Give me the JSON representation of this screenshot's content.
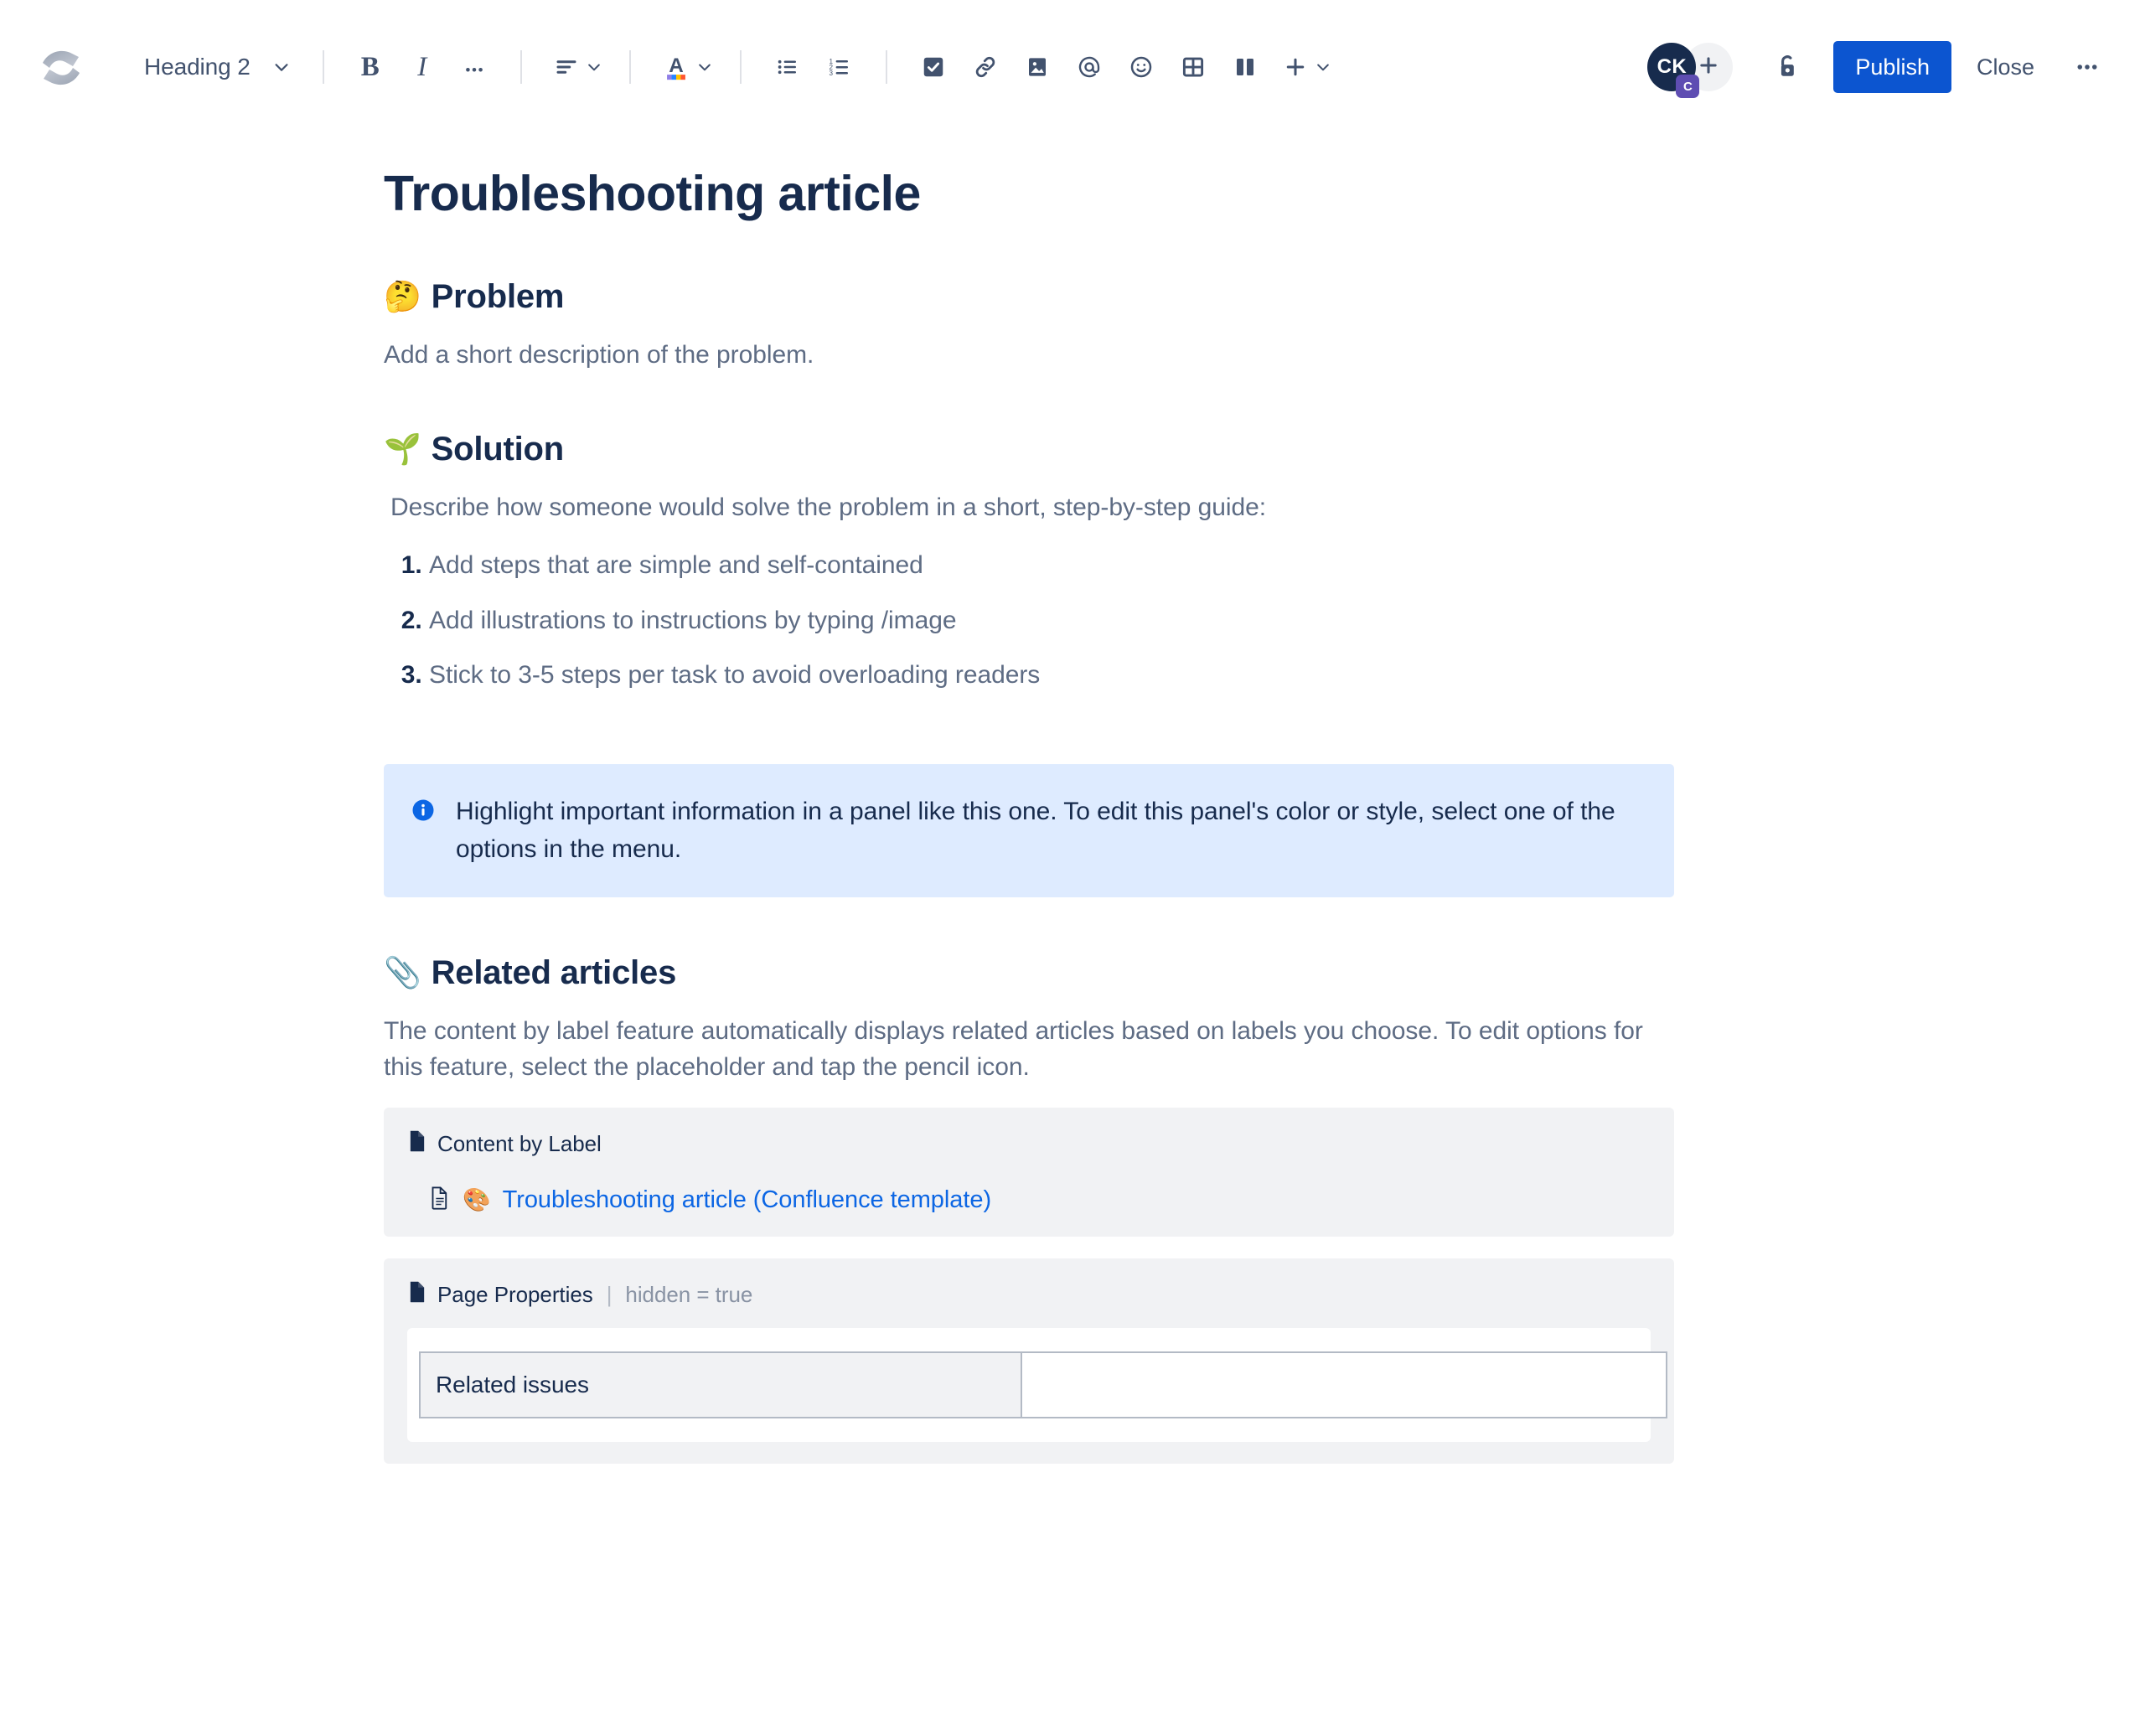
{
  "app": {
    "logo_icon": "confluence-logo-icon"
  },
  "toolbar": {
    "style_select": {
      "value": "Heading 2",
      "icon": "chevron-down-icon"
    },
    "bold": {
      "label": "B",
      "icon": "bold-icon"
    },
    "italic": {
      "label": "I",
      "icon": "italic-icon"
    },
    "more_formatting": {
      "icon": "ellipsis-icon"
    },
    "alignment": {
      "icon": "text-align-left-icon"
    },
    "text_color": {
      "icon": "text-color-icon"
    },
    "bullet_list": {
      "icon": "bullet-list-icon"
    },
    "numbered_list": {
      "icon": "numbered-list-icon"
    },
    "task_list": {
      "icon": "checkbox-icon"
    },
    "link": {
      "icon": "link-icon"
    },
    "image": {
      "icon": "image-icon"
    },
    "mention": {
      "icon": "mention-at-icon"
    },
    "emoji": {
      "icon": "emoji-smiley-icon"
    },
    "table": {
      "icon": "table-icon"
    },
    "layout": {
      "icon": "columns-layout-icon"
    },
    "insert_more": {
      "icon": "plus-icon"
    },
    "avatar": {
      "initials": "CK",
      "badge": "C"
    },
    "add_people": {
      "icon": "plus-icon"
    },
    "restrictions": {
      "icon": "unlock-icon"
    },
    "publish_label": "Publish",
    "close_label": "Close",
    "more_options": {
      "icon": "ellipsis-icon"
    }
  },
  "colors": {
    "accent_blue": "#0C55D0",
    "link_blue": "#0C66E4",
    "panel_bg": "#DEEBFF",
    "macro_bg": "#F1F2F4",
    "text_dark": "#172B4D",
    "text_muted": "#5E6C84",
    "badge_purple": "#5E4DB2"
  },
  "document": {
    "title": "Troubleshooting article",
    "sections": [
      {
        "emoji": "🤔",
        "emoji_name": "thinking-face-emoji",
        "heading": "Problem",
        "paragraph": "Add a short description of the problem."
      },
      {
        "emoji": "🌱",
        "emoji_name": "seedling-emoji",
        "heading": "Solution",
        "paragraph": "Describe how someone would solve the problem in a short, step-by-step guide:",
        "steps": [
          "Add steps that are simple and self-contained",
          "Add illustrations to instructions by typing /image",
          "Stick to 3-5 steps per task to avoid overloading readers"
        ]
      },
      {
        "emoji": "📎",
        "emoji_name": "paperclip-emoji",
        "heading": "Related articles",
        "paragraph": "The content by label feature automatically displays related articles based on labels you choose. To edit options for this feature, select the placeholder and tap the pencil icon."
      }
    ],
    "info_panel": {
      "icon": "info-circle-icon",
      "text": "Highlight important information in a panel like this one. To edit this panel's color or style, select one of the options in the menu."
    },
    "content_by_label_macro": {
      "icon": "macro-page-icon",
      "title": "Content by Label",
      "items": [
        {
          "doc_icon": "page-document-icon",
          "emoji": "🎨",
          "emoji_name": "artist-palette-emoji",
          "label": "Troubleshooting article (Confluence template)"
        }
      ]
    },
    "page_properties_macro": {
      "icon": "macro-page-icon",
      "title": "Page Properties",
      "separator": "|",
      "parameter": "hidden = true",
      "rows": [
        {
          "key": "Related issues",
          "value": ""
        }
      ]
    }
  }
}
